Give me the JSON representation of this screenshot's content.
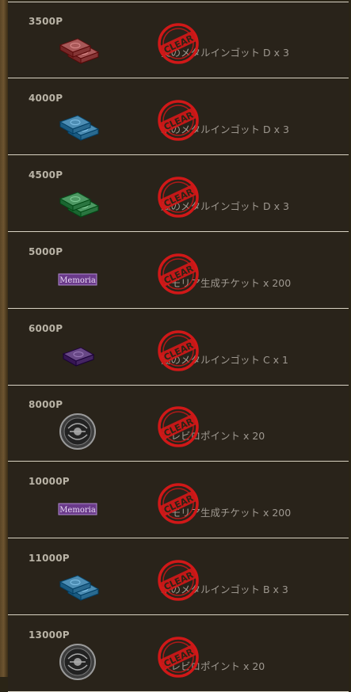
{
  "rewards": [
    {
      "points": "3500P",
      "icon": "red-metal-ingot-icon",
      "color": "#8a3a3a",
      "kind": "ingot",
      "stamp": "CLEAR",
      "text": "炎のメタルインゴット D x 3"
    },
    {
      "points": "4000P",
      "icon": "blue-metal-ingot-icon",
      "color": "#2f6f95",
      "kind": "ingot",
      "stamp": "CLEAR",
      "text": "水のメタルインゴット D x 3"
    },
    {
      "points": "4500P",
      "icon": "green-metal-ingot-icon",
      "color": "#2f7a45",
      "kind": "ingot",
      "stamp": "CLEAR",
      "text": "風のメタルインゴット D x 3"
    },
    {
      "points": "5000P",
      "icon": "memoria-ticket-icon",
      "color": "#6a3a8a",
      "kind": "ticket",
      "ticket_label": "Memoria",
      "stamp": "CLEAR",
      "text": "メモリア生成チケット x 200"
    },
    {
      "points": "6000P",
      "icon": "purple-metal-ingot-icon",
      "color": "#4a2a68",
      "kind": "ingot-single",
      "stamp": "CLEAR",
      "text": "闇のメタルインゴット C x 1"
    },
    {
      "points": "8000P",
      "icon": "medal-coin-icon",
      "color": "#555555",
      "kind": "coin",
      "stamp": "CLEAR",
      "text": "ブレビロポイント x 20"
    },
    {
      "points": "10000P",
      "icon": "memoria-ticket-icon",
      "color": "#6a3a8a",
      "kind": "ticket",
      "ticket_label": "Memoria",
      "stamp": "CLEAR",
      "text": "メモリア生成チケット x 200"
    },
    {
      "points": "11000P",
      "icon": "blue-metal-ingot-icon",
      "color": "#2f6f95",
      "kind": "ingot",
      "stamp": "CLEAR",
      "text": "水のメタルインゴット B x 3"
    },
    {
      "points": "13000P",
      "icon": "medal-coin-icon",
      "color": "#555555",
      "kind": "coin",
      "stamp": "CLEAR",
      "text": "ブレビロポイント x 20"
    }
  ],
  "stamp_color": "#d01818"
}
